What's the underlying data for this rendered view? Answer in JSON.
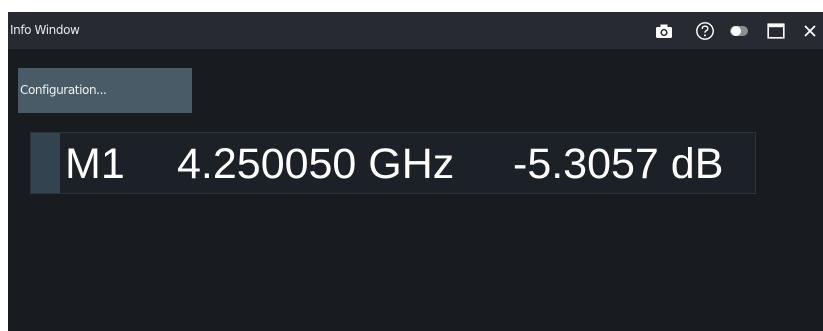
{
  "window": {
    "title": "Info Window"
  },
  "titlebar": {
    "buttons": [
      {
        "icon": "camera-icon"
      },
      {
        "icon": "help-icon"
      },
      {
        "icon": "toggle-icon"
      },
      {
        "icon": "maximize-icon"
      },
      {
        "icon": "close-icon"
      }
    ]
  },
  "config": {
    "label": "Configuration..."
  },
  "marker": {
    "name": "M1",
    "frequency": "4.250050 GHz",
    "value": "-5.3057 dB"
  },
  "colors": {
    "window_bg": "#181b20",
    "titlebar_bg": "#272a30",
    "button_bg": "#4a5b68",
    "marker_stripe": "#344350"
  }
}
